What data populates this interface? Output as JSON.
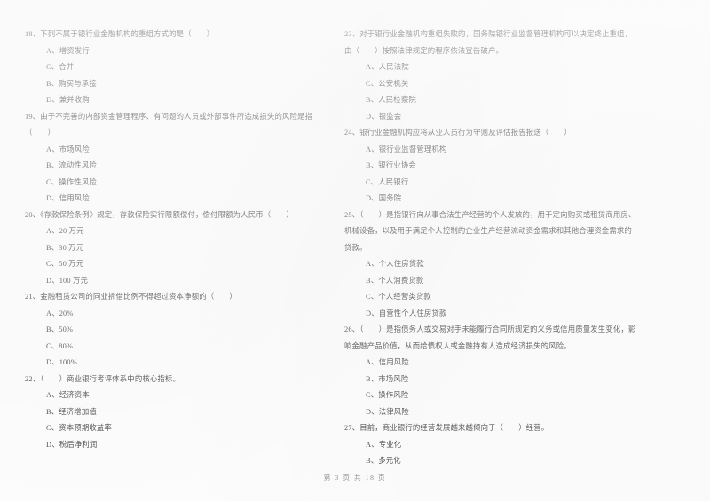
{
  "document": {
    "type": "exam-paper",
    "language": "zh-CN",
    "footer": "第 3 页 共 18 页",
    "page_number": "3",
    "total_pages": "18",
    "background_color": "#fdfdfd",
    "text_color": "#3c3c3c"
  },
  "columns": {
    "left": [
      {
        "number": "18",
        "stem": "18、下列不属于银行业金融机构的重组方式的是（　　）",
        "options": [
          "A、增资发行",
          "C、合并",
          "B、购买与承接",
          "D、兼并收购"
        ]
      },
      {
        "number": "19",
        "stem": "19、由于不完善的内部资金管理程序、有问题的人员或外部事件所造成损失的风险是指（　　）",
        "options": [
          "A、市场风险",
          "B、流动性风险",
          "C、操作性风险",
          "D、信用风险"
        ]
      },
      {
        "number": "20",
        "stem": "20、《存款保险条例》规定，存款保险实行限额偿付，偿付限额为人民币（　　）",
        "options": [
          "A、20 万元",
          "B、30 万元",
          "C、50 万元",
          "D、100 万元"
        ]
      },
      {
        "number": "21",
        "stem": "21、金融租赁公司的同业拆借比例不得超过资本净额的（　　）",
        "options": [
          "A、20%",
          "B、50%",
          "C、80%",
          "D、100%"
        ]
      },
      {
        "number": "22",
        "stem": "22、（　　）商业银行考评体系中的核心指标。",
        "options": [
          "A、经济资本",
          "B、经济增加值",
          "C、资本预期收益率",
          "D、税后净利润"
        ]
      }
    ],
    "right": [
      {
        "number": "23",
        "stem": "23、对于银行业金融机构重组失败的，国务院银行业监督管理机构可以决定终止重组，由（　　）按照法律规定的程序依法宣告破产。",
        "options": [
          "A、人民法院",
          "C、公安机关",
          "B、人民检察院",
          "D、银监会"
        ]
      },
      {
        "number": "24",
        "stem": "24、银行业金融机构应将从业人员行为守则及评估报告报送（　　）",
        "options": [
          "A、银行业监督管理机构",
          "B、银行业协会",
          "C、人民银行",
          "D、国务院"
        ]
      },
      {
        "number": "25",
        "stem": "25、（　　）是指银行向从事合法生产经营的个人发放的，用于定向购买或租赁商用房、机械设备，以及用于满足个人控制的企业生产经营流动资金需求和其他合理资金需求的贷款。",
        "options": [
          "A、个人住房贷款",
          "B、个人消费贷款",
          "C、个人经营类贷款",
          "D、自营性个人住房贷款"
        ]
      },
      {
        "number": "26",
        "stem": "26、（　　）是指债务人或交易对手未能履行合同所规定的义务或信用质量发生变化，影响金融产品价值，从而给债权人或金融持有人造成经济损失的风险。",
        "options": [
          "A、信用风险",
          "B、市场风险",
          "C、操作风险",
          "D、法律风险"
        ]
      },
      {
        "number": "27",
        "stem": "27、目前，商业银行的经营发展越来越倾向于（　　）经营。",
        "options": [
          "A、专业化",
          "B、多元化"
        ]
      }
    ]
  }
}
